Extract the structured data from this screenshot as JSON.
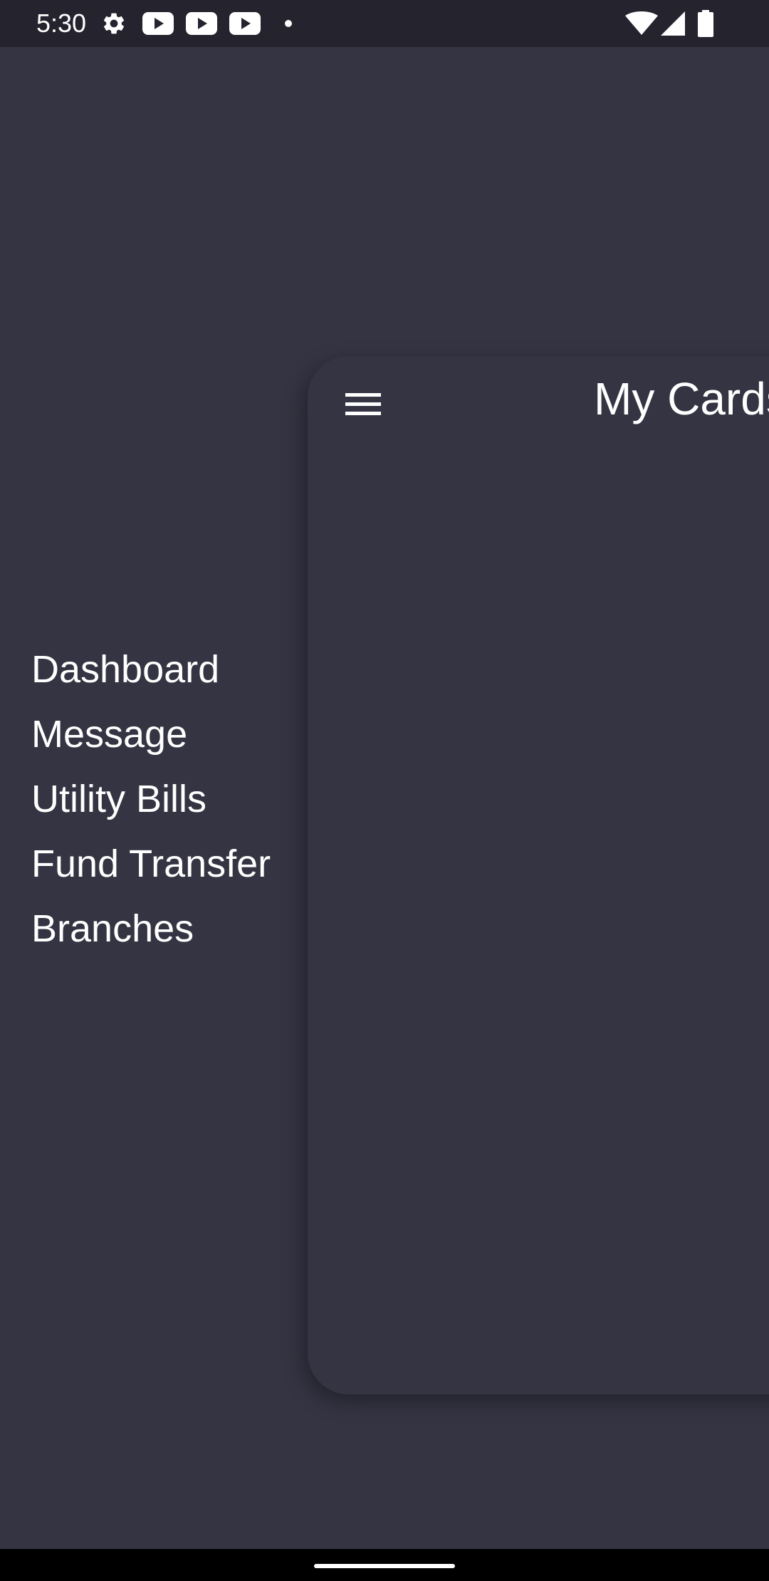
{
  "status_bar": {
    "time": "5:30",
    "icons_left": [
      "settings-icon",
      "youtube-icon",
      "youtube-icon",
      "youtube-icon",
      "notification-dot-icon"
    ],
    "icons_right": [
      "wifi-icon",
      "cellular-signal-icon",
      "battery-icon"
    ]
  },
  "side_menu": {
    "items": [
      {
        "label": "Dashboard"
      },
      {
        "label": "Message"
      },
      {
        "label": "Utility Bills"
      },
      {
        "label": "Fund Transfer"
      },
      {
        "label": "Branches"
      }
    ]
  },
  "main": {
    "title": "My Cards",
    "menu_icon": "hamburger-menu-icon"
  },
  "colors": {
    "background": "#353443",
    "status_bar": "#25242e",
    "text": "#ffffff"
  }
}
